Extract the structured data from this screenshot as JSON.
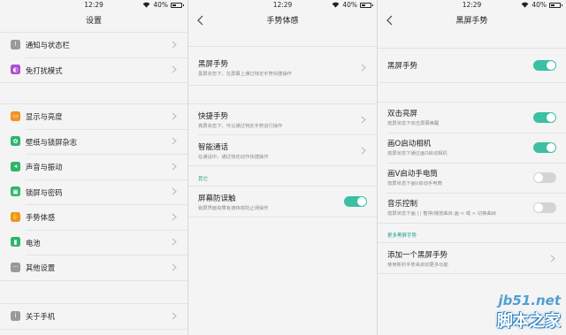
{
  "status": {
    "time": "12:29",
    "battery": "40%",
    "battery_level": 0.4
  },
  "screen1": {
    "title": "设置",
    "group1": [
      {
        "label": "通知与状态栏",
        "icon": "notification-icon",
        "color": "#9a9a9a"
      },
      {
        "label": "免打扰模式",
        "icon": "moon-icon",
        "color": "#b04fd1"
      }
    ],
    "group2": [
      {
        "label": "显示与亮度",
        "icon": "display-icon",
        "color": "#f39222"
      },
      {
        "label": "壁纸与锁屏杂志",
        "icon": "flower-icon",
        "color": "#2fb56d"
      },
      {
        "label": "声音与振动",
        "icon": "speaker-icon",
        "color": "#2fb56d"
      },
      {
        "label": "锁屏与密码",
        "icon": "lock-icon",
        "color": "#2fb56d"
      },
      {
        "label": "手势体感",
        "icon": "hand-icon",
        "color": "#f39222"
      },
      {
        "label": "电池",
        "icon": "battery-icon",
        "color": "#2fb56d"
      },
      {
        "label": "其他设置",
        "icon": "more-icon",
        "color": "#9a9a9a"
      }
    ],
    "group3": [
      {
        "label": "关于手机",
        "icon": "info-icon",
        "color": "#9a9a9a"
      }
    ]
  },
  "screen2": {
    "title": "手势体感",
    "black_gesture": {
      "title": "黑屏手势",
      "subtitle": "黑屏状态下，在屏幕上通过特定手势快捷操作"
    },
    "quick_gesture": {
      "title": "快捷手势",
      "subtitle": "亮屏状态下，可以通过特定手势进行操作"
    },
    "smart_call": {
      "title": "智能通话",
      "subtitle": "在通话中，通过特定动作快捷操作"
    },
    "section_other": "其它",
    "anti_touch": {
      "title": "屏幕防误触",
      "subtitle": "锁屏界面如果有遮挡将防止误操作",
      "enabled": true
    }
  },
  "screen3": {
    "title": "黑屏手势",
    "master": {
      "title": "黑屏手势",
      "enabled": true
    },
    "items": [
      {
        "title": "双击亮屏",
        "subtitle": "熄屏状态下双击屏幕唤醒",
        "enabled": true
      },
      {
        "title": "画O启动相机",
        "subtitle": "熄屏状态下通过画O启动相机",
        "enabled": true
      },
      {
        "title": "画V启动手电筒",
        "subtitle": "熄屏状态下画V启动手电筒",
        "enabled": false
      },
      {
        "title": "音乐控制",
        "subtitle": "熄屏状态下画 | | 暂停/播放曲目,画 < 或 > 切换曲目",
        "enabled": false
      }
    ],
    "section_more": "更多黑屏手势",
    "add_gesture": {
      "title": "添加一个黑屏手势",
      "subtitle": "使用新的手势来启动更多功能"
    }
  },
  "watermark": {
    "line1": "jb51.net",
    "line2": "脚本之家"
  }
}
